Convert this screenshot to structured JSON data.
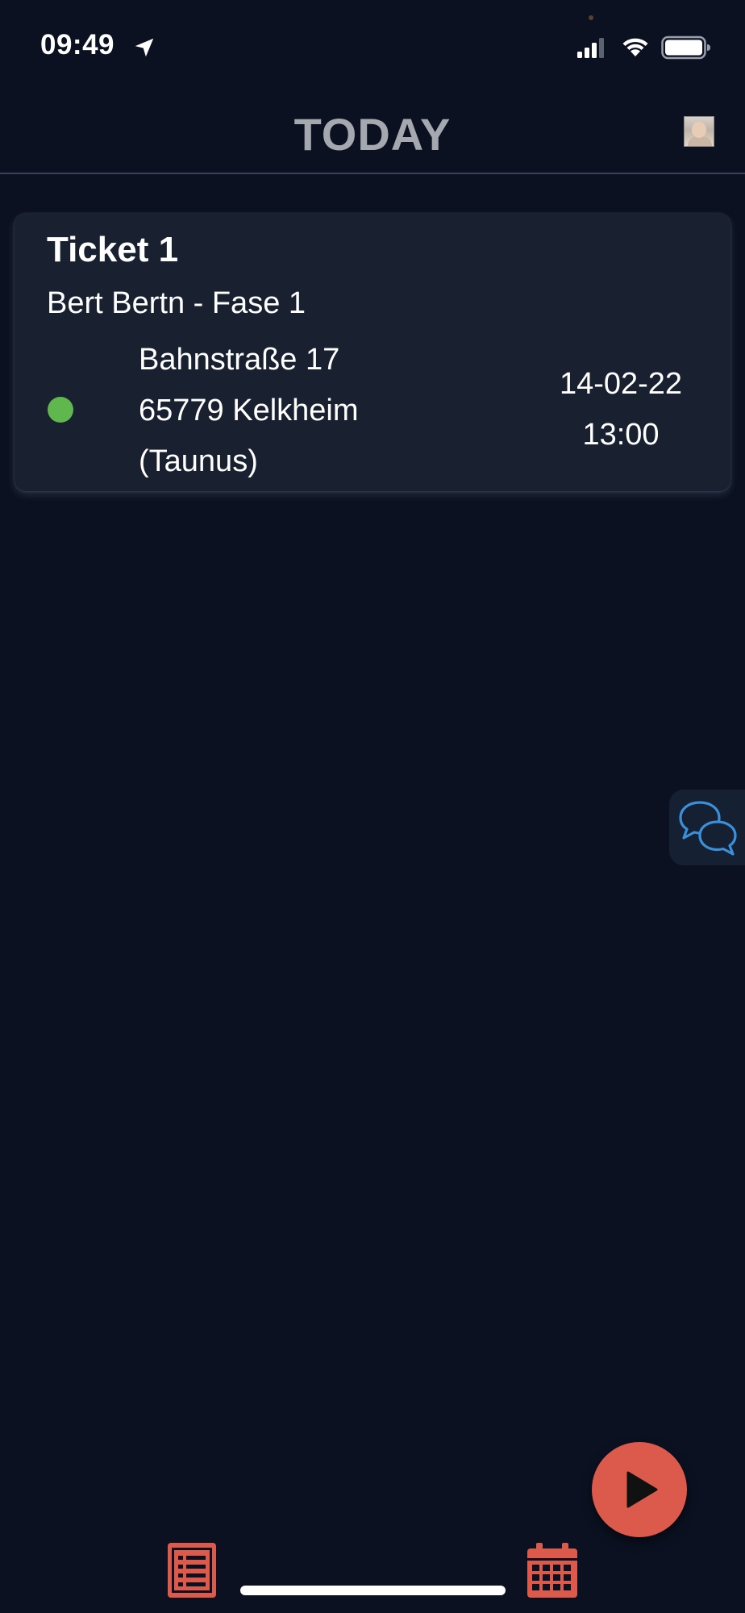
{
  "status_bar": {
    "time": "09:49"
  },
  "header": {
    "title": "TODAY"
  },
  "tickets": [
    {
      "title": "Ticket 1",
      "subtitle": "Bert Bertn - Fase 1",
      "status_color": "#5fb74e",
      "address_lines": [
        "Bahnstraße 17",
        "65779 Kelkheim",
        "(Taunus)"
      ],
      "date": "14-02-22",
      "time": "13:00"
    }
  ],
  "colors": {
    "background": "#0b1121",
    "card": "#192131",
    "accent": "#dc5a4c",
    "chat_icon": "#3b8fd8",
    "title_gray": "#a5a8ae"
  },
  "icons": {
    "status_bar": [
      "location-arrow-icon",
      "signal-icon",
      "wifi-icon",
      "battery-icon"
    ],
    "chat": "chat-bubbles-icon",
    "fab": "play-icon",
    "nav": [
      "list-icon",
      "calendar-icon"
    ]
  }
}
